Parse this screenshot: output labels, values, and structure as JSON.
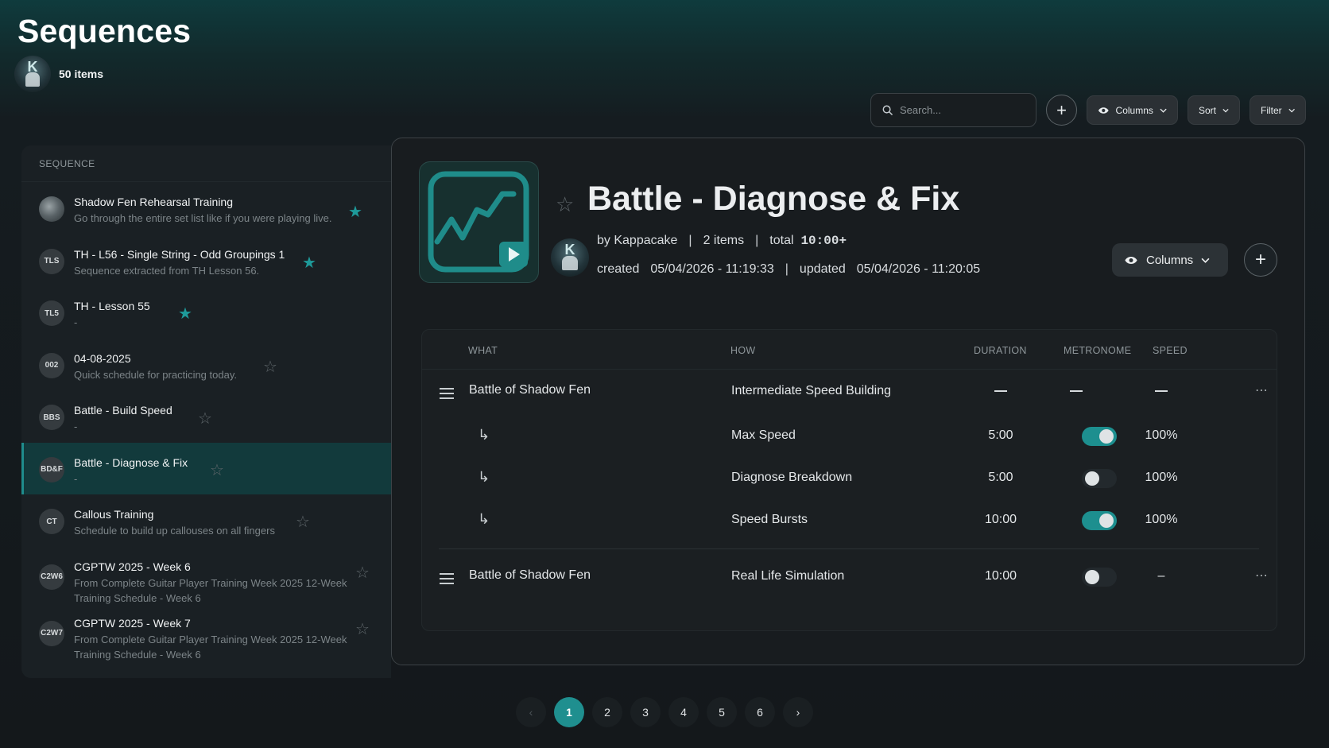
{
  "header": {
    "title": "Sequences",
    "owner_initial": "K",
    "item_count": "50 items"
  },
  "toolbar": {
    "search_placeholder": "Search...",
    "columns_label": "Columns",
    "sort_label": "Sort",
    "filter_label": "Filter"
  },
  "sidebar": {
    "heading": "SEQUENCE",
    "items": [
      {
        "badge": "",
        "title": "Shadow Fen Rehearsal Training",
        "subtitle": "Go through the entire set list like if you were playing live.",
        "starred": true
      },
      {
        "badge": "TLS",
        "title": "TH - L56 - Single String - Odd Groupings 1",
        "subtitle": "Sequence extracted from TH Lesson 56.",
        "starred": true
      },
      {
        "badge": "TL5",
        "title": "TH - Lesson 55",
        "subtitle": "-",
        "starred": true
      },
      {
        "badge": "002",
        "title": "04-08-2025",
        "subtitle": "Quick schedule for practicing today.",
        "starred": false
      },
      {
        "badge": "BBS",
        "title": "Battle - Build Speed",
        "subtitle": "-",
        "starred": false
      },
      {
        "badge": "BD&F",
        "title": "Battle - Diagnose & Fix",
        "subtitle": "-",
        "starred": false
      },
      {
        "badge": "CT",
        "title": "Callous Training",
        "subtitle": "Schedule to build up callouses on all fingers",
        "starred": false
      },
      {
        "badge": "C2W6",
        "title": "CGPTW 2025 - Week 6",
        "subtitle_line1": "From Complete Guitar Player Training Week 2025 12-Week",
        "subtitle_line2": "Training Schedule - Week 6",
        "starred": false
      },
      {
        "badge": "C2W7",
        "title": "CGPTW 2025 - Week 7",
        "subtitle_line1": "From Complete Guitar Player Training Week 2025 12-Week",
        "subtitle_line2": "Training Schedule - Week 6",
        "starred": false
      }
    ]
  },
  "detail": {
    "title": "Battle - Diagnose & Fix",
    "owner_initial": "K",
    "by": "by Kappacake",
    "items": "2 items",
    "total_label": "total",
    "total_value": "10:00+",
    "created_label": "created",
    "created_value": "05/04/2026 - 11:19:33",
    "updated_label": "updated",
    "updated_value": "05/04/2026 - 11:20:05",
    "columns_label": "Columns"
  },
  "table": {
    "headers": {
      "what": "WHAT",
      "how": "HOW",
      "duration": "DURATION",
      "metronome": "METRONOME",
      "speed": "SPEED"
    },
    "groups": [
      {
        "what": "Battle of Shadow Fen",
        "how": "Intermediate Speed Building"
      },
      {
        "what": "Battle of Shadow Fen",
        "how": "Real Life Simulation",
        "duration": "10:00",
        "metronome": false,
        "speed": "–"
      }
    ],
    "sub_rows": [
      {
        "how": "Max Speed",
        "duration": "5:00",
        "metronome": true,
        "speed": "100%"
      },
      {
        "how": "Diagnose Breakdown",
        "duration": "5:00",
        "metronome": false,
        "speed": "100%"
      },
      {
        "how": "Speed Bursts",
        "duration": "10:00",
        "metronome": true,
        "speed": "100%"
      }
    ]
  },
  "pagination": {
    "pages": [
      "1",
      "2",
      "3",
      "4",
      "5",
      "6"
    ],
    "current": "1"
  },
  "colors": {
    "accent": "#1f8f8f",
    "panel": "#181c1f",
    "background": "#14181b"
  }
}
